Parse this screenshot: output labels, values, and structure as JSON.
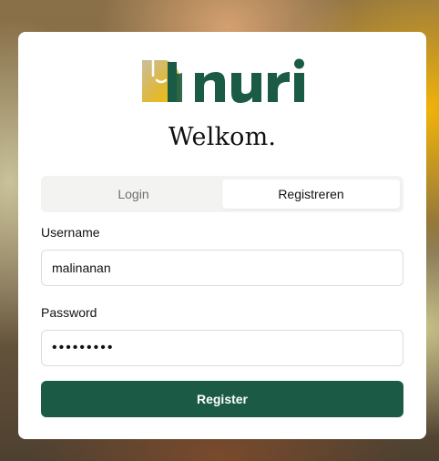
{
  "brand": {
    "name": "nuri",
    "primary_color": "#1b5b45"
  },
  "heading": "Welkom.",
  "tabs": [
    {
      "label": "Login",
      "active": false
    },
    {
      "label": "Registreren",
      "active": true
    }
  ],
  "form": {
    "username_label": "Username",
    "username_value": "malinanan",
    "password_label": "Password",
    "password_value": "•••••••••",
    "submit_label": "Register"
  }
}
